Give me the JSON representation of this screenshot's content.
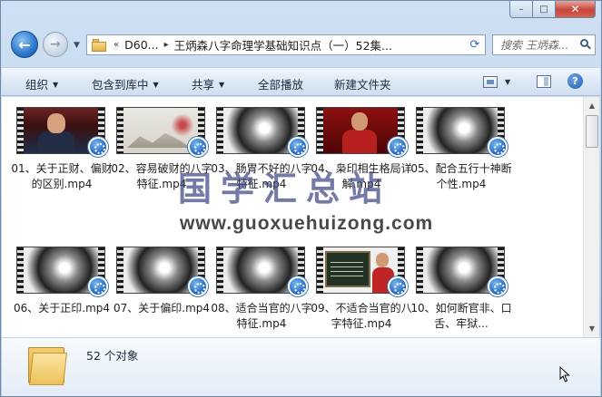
{
  "window": {
    "caption_min": "–",
    "caption_max": "□",
    "caption_close": "✕"
  },
  "nav": {
    "back_icon": "←",
    "forward_icon": "→",
    "address": {
      "prefix": "«",
      "drive": "D60...",
      "separator": "▸",
      "path": "王炳森八字命理学基础知识点（一）52集..."
    },
    "search_placeholder": "搜索 王炳森..."
  },
  "commands": {
    "organize": "组织",
    "include_in_library": "包含到库中",
    "share": "共享",
    "play_all": "全部播放",
    "new_folder": "新建文件夹"
  },
  "files": [
    {
      "name": "01、关于正财、偏财的区别.mp4",
      "thumb": "studio"
    },
    {
      "name": "02、容易破财的八字特征.mp4",
      "thumb": "paint"
    },
    {
      "name": "03、肠胃不好的八字特征.mp4",
      "thumb": "ink"
    },
    {
      "name": "04、枭印相生格局详解.mp4",
      "thumb": "red"
    },
    {
      "name": "05、配合五行十神断个性.mp4",
      "thumb": "ink"
    },
    {
      "name": "06、关于正印.mp4",
      "thumb": "ink"
    },
    {
      "name": "07、关于偏印.mp4",
      "thumb": "ink"
    },
    {
      "name": "08、适合当官的八字特征.mp4",
      "thumb": "ink"
    },
    {
      "name": "09、不适合当官的八字特征.mp4",
      "thumb": "board"
    },
    {
      "name": "10、如何断官非、口舌、牢狱...",
      "thumb": "ink"
    }
  ],
  "watermark": {
    "title": "国学汇总站",
    "url": "www.guoxuehuizong.com"
  },
  "status": {
    "object_count": "52 个对象"
  },
  "colors": {
    "accent": "#2a76c9",
    "close": "#c7463a",
    "watermark": "#3c4682"
  }
}
